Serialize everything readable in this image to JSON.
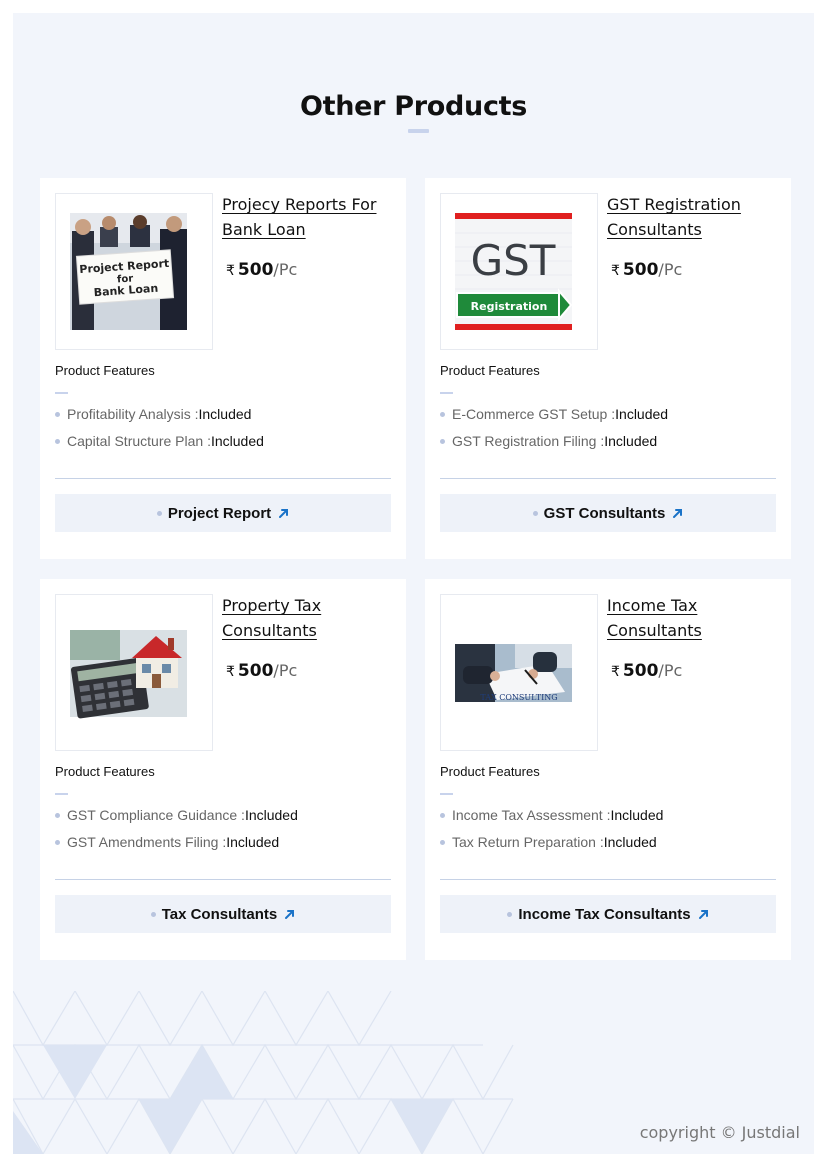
{
  "heading": "Other Products",
  "products": [
    {
      "title": "Projecy Reports For Bank Loan",
      "currency": "₹",
      "price": "500",
      "unit": "/Pc",
      "features_label": "Product Features",
      "features": [
        {
          "name": "Profitability Analysis : ",
          "value": "Included"
        },
        {
          "name": "Capital Structure Plan : ",
          "value": "Included"
        }
      ],
      "button": "Project Report",
      "image_text": [
        "Project Report",
        "for",
        "Bank Loan"
      ]
    },
    {
      "title": "GST Registration Consultants",
      "currency": "₹",
      "price": "500",
      "unit": "/Pc",
      "features_label": "Product Features",
      "features": [
        {
          "name": "E-Commerce GST Setup : ",
          "value": "Included"
        },
        {
          "name": "GST Registration Filing : ",
          "value": "Included"
        }
      ],
      "button": "GST Consultants",
      "image_text": [
        "GST",
        "Registration"
      ]
    },
    {
      "title": "Property Tax Consultants",
      "currency": "₹",
      "price": "500",
      "unit": "/Pc",
      "features_label": "Product Features",
      "features": [
        {
          "name": "GST Compliance Guidance : ",
          "value": "Included"
        },
        {
          "name": "GST Amendments Filing : ",
          "value": "Included"
        }
      ],
      "button": "Tax Consultants",
      "image_text": []
    },
    {
      "title": "Income Tax Consultants",
      "currency": "₹",
      "price": "500",
      "unit": "/Pc",
      "features_label": "Product Features",
      "features": [
        {
          "name": "Income Tax Assessment : ",
          "value": "Included"
        },
        {
          "name": "Tax Return Preparation : ",
          "value": "Included"
        }
      ],
      "button": "Income Tax Consultants",
      "image_text": [
        "TAX CONSULTING"
      ]
    }
  ],
  "copyright": "copyright © Justdial",
  "colors": {
    "page_bg": "#f2f5fb",
    "card_bg": "#ffffff",
    "button_bg": "#eef2f9",
    "accent_arrow": "#1a73c8",
    "bullet": "#b8c4de"
  },
  "icons": {
    "button_arrow": "arrow-up-right-icon",
    "rupee": "rupee-icon"
  }
}
